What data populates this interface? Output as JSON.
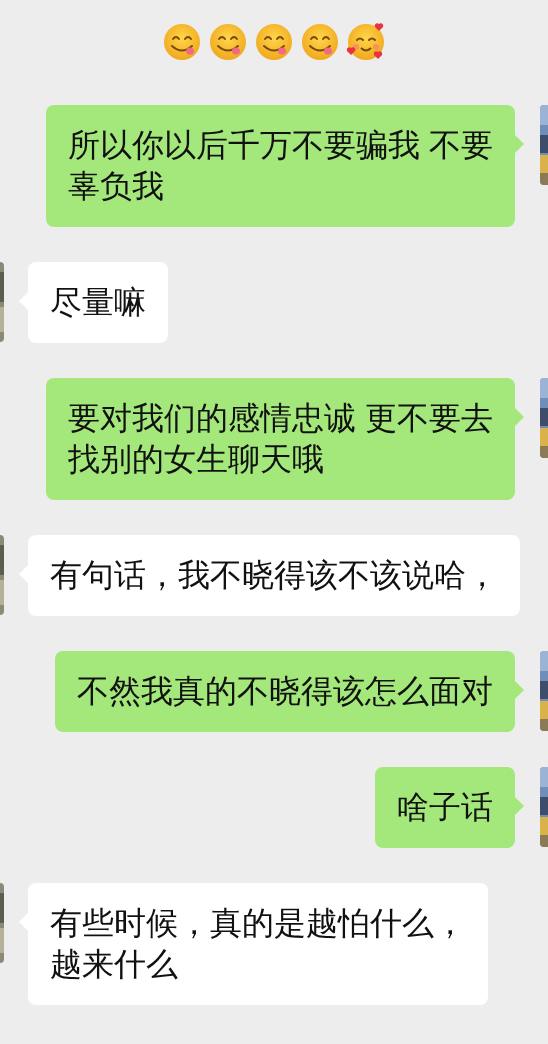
{
  "emoji_row": [
    {
      "kind": "yum"
    },
    {
      "kind": "yum"
    },
    {
      "kind": "yum"
    },
    {
      "kind": "yum"
    },
    {
      "kind": "hearts"
    }
  ],
  "messages": [
    {
      "outgoing": true,
      "lines": [
        "所以你以后千万不要骗我 不要",
        "辜负我"
      ]
    },
    {
      "outgoing": false,
      "lines": [
        "尽量嘛"
      ]
    },
    {
      "outgoing": true,
      "lines": [
        "要对我们的感情忠诚 更不要去",
        "找别的女生聊天哦"
      ]
    },
    {
      "outgoing": false,
      "lines": [
        "有句话，我不晓得该不该说哈，"
      ]
    },
    {
      "outgoing": true,
      "lines": [
        "不然我真的不晓得该怎么面对"
      ]
    },
    {
      "outgoing": true,
      "lines": [
        "啥子话"
      ]
    },
    {
      "outgoing": false,
      "lines": [
        "有些时候，真的是越怕什么，",
        "越来什么"
      ]
    }
  ]
}
